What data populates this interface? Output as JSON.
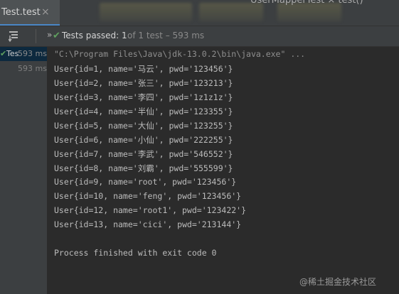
{
  "tabs": {
    "active_title": "Test.test",
    "close_glyph": "×",
    "background_title": "UserMapperTest  ×  test()"
  },
  "toolbar": {
    "pass_status_text": "Tests passed: 1",
    "pass_detail_text": " of 1 test – 593 ms"
  },
  "tree": {
    "root_label": "Tes",
    "root_time": "593 ms",
    "child_time": "593 ms"
  },
  "console": {
    "command": "\"C:\\Program Files\\Java\\jdk-13.0.2\\bin\\java.exe\" ...",
    "output_lines": [
      "User{id=1, name='马云', pwd='123456'}",
      "User{id=2, name='张三', pwd='123213'}",
      "User{id=3, name='李四', pwd='1z1z1z'}",
      "User{id=4, name='半仙', pwd='123355'}",
      "User{id=5, name='大仙', pwd='123255'}",
      "User{id=6, name='小仙', pwd='222255'}",
      "User{id=7, name='李武', pwd='546552'}",
      "User{id=8, name='刘霸', pwd='555599'}",
      "User{id=9, name='root', pwd='123456'}",
      "User{id=10, name='feng', pwd='123456'}",
      "User{id=12, name='root1', pwd='123422'}",
      "User{id=13, name='cici', pwd='213144'}"
    ],
    "exit_message": "Process finished with exit code 0"
  },
  "watermark": "@稀土掘金技术社区",
  "colors": {
    "pass_green": "#5fa05f",
    "console_bg": "#2b2b2b",
    "panel_bg": "#3c3f41",
    "selection": "#0d293e"
  },
  "icons": [
    "sort-icon",
    "expand-icon",
    "check-icon",
    "close-icon"
  ]
}
